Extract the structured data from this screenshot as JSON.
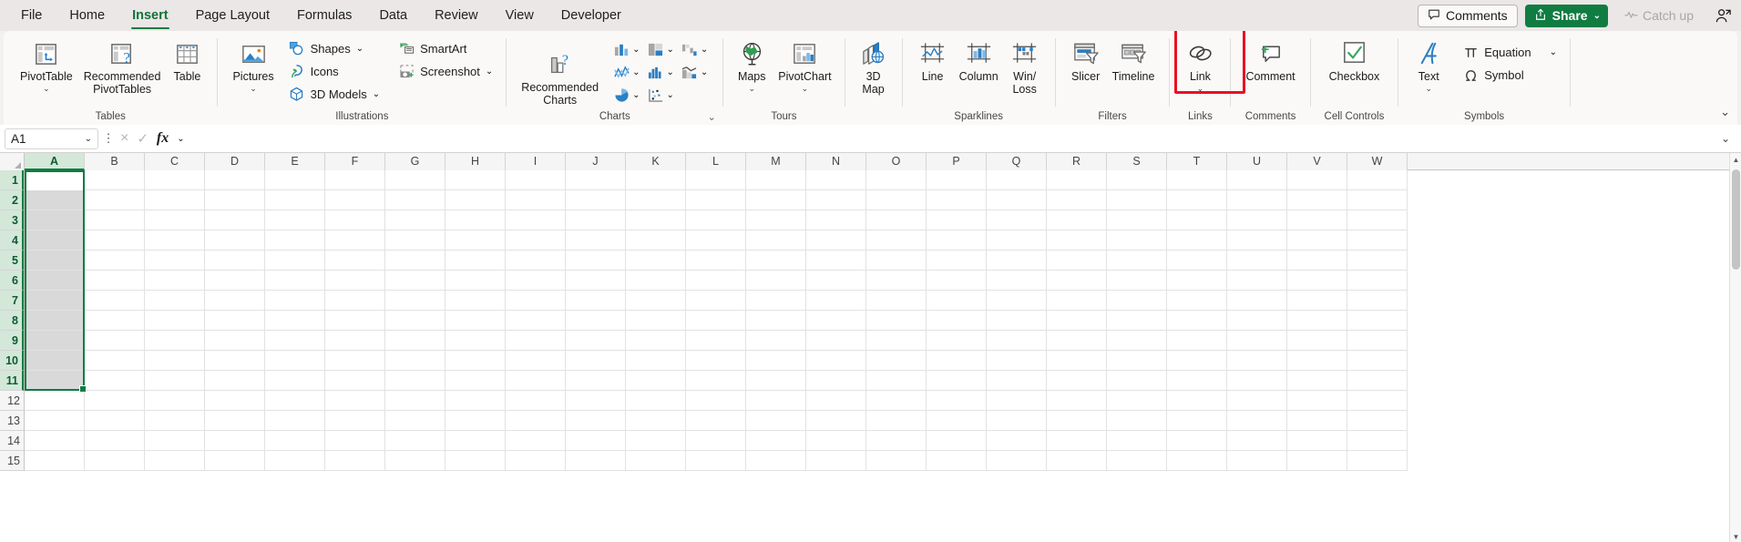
{
  "tabs": [
    {
      "label": "File",
      "active": false
    },
    {
      "label": "Home",
      "active": false
    },
    {
      "label": "Insert",
      "active": true
    },
    {
      "label": "Page Layout",
      "active": false
    },
    {
      "label": "Formulas",
      "active": false
    },
    {
      "label": "Data",
      "active": false
    },
    {
      "label": "Review",
      "active": false
    },
    {
      "label": "View",
      "active": false
    },
    {
      "label": "Developer",
      "active": false
    }
  ],
  "titlebar": {
    "comments_label": "Comments",
    "share_label": "Share",
    "catchup_label": "Catch up",
    "share_accent": "#107c41"
  },
  "ribbon": {
    "collapse_glyph": "⌄",
    "groups": {
      "tables": {
        "label": "Tables",
        "pivottable": "PivotTable",
        "recommended_pivottables": "Recommended\nPivotTables",
        "table": "Table"
      },
      "illustrations": {
        "label": "Illustrations",
        "pictures": "Pictures",
        "shapes": "Shapes",
        "icons": "Icons",
        "models3d": "3D Models",
        "smartart": "SmartArt",
        "screenshot": "Screenshot"
      },
      "charts": {
        "label": "Charts",
        "recommended_charts": "Recommended\nCharts"
      },
      "tours": {
        "label": "Tours",
        "maps": "Maps",
        "pivotchart": "PivotChart",
        "map3d": "3D\nMap"
      },
      "sparklines": {
        "label": "Sparklines",
        "line": "Line",
        "column": "Column",
        "winloss": "Win/\nLoss"
      },
      "filters": {
        "label": "Filters",
        "slicer": "Slicer",
        "timeline": "Timeline"
      },
      "links": {
        "label": "Links",
        "link": "Link"
      },
      "comments": {
        "label": "Comments",
        "comment": "Comment"
      },
      "cell_controls": {
        "label": "Cell Controls",
        "checkbox": "Checkbox",
        "highlight_color": "#e81123"
      },
      "symbols": {
        "label": "Symbols",
        "text": "Text",
        "equation": "Equation",
        "symbol": "Symbol"
      }
    }
  },
  "formula_bar": {
    "name_box_value": "A1",
    "formula_value": "",
    "cancel_icon": "×",
    "enter_icon": "✓",
    "fx_label": "fx"
  },
  "grid": {
    "columns": [
      "A",
      "B",
      "C",
      "D",
      "E",
      "F",
      "G",
      "H",
      "I",
      "J",
      "K",
      "L",
      "M",
      "N",
      "O",
      "P",
      "Q",
      "R",
      "S",
      "T",
      "U",
      "V",
      "W"
    ],
    "rows": [
      "1",
      "2",
      "3",
      "4",
      "5",
      "6",
      "7",
      "8",
      "9",
      "10",
      "11",
      "12",
      "13",
      "14",
      "15"
    ],
    "selected_column": "A",
    "selected_rows": [
      "1",
      "2",
      "3",
      "4",
      "5",
      "6",
      "7",
      "8",
      "9",
      "10",
      "11"
    ],
    "active_cell": "A1",
    "selection_color": "#107c41"
  }
}
